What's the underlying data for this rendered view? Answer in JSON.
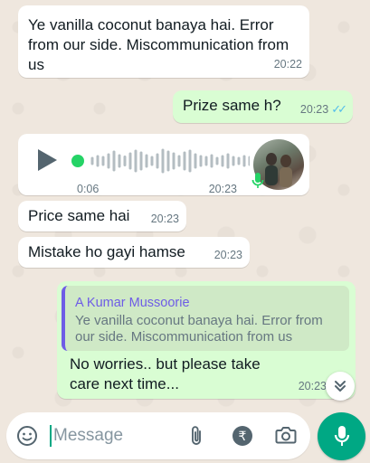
{
  "messages": [
    {
      "id": "m1",
      "direction": "incoming",
      "text": "Ye vanilla coconut banaya hai. Error from our side. Miscommunication from us",
      "time": "20:22"
    },
    {
      "id": "m2",
      "direction": "outgoing",
      "text": "Prize same h?",
      "time": "20:23",
      "status": "read"
    },
    {
      "id": "voice",
      "direction": "incoming",
      "type": "voice",
      "duration": "0:06",
      "time": "20:23"
    },
    {
      "id": "m3",
      "direction": "incoming",
      "text": "Price same hai",
      "time": "20:23"
    },
    {
      "id": "m4",
      "direction": "incoming",
      "text": "Mistake ho gayi hamse",
      "time": "20:23"
    },
    {
      "id": "m5",
      "direction": "outgoing",
      "text": "No worries.. but please take care next time...",
      "time": "20:23",
      "reply_to": {
        "author": "A Kumar Mussoorie",
        "text": "Ye vanilla coconut banaya hai. Error from our side. Miscommunication from us"
      }
    }
  ],
  "input": {
    "placeholder": "Message"
  },
  "colors": {
    "accent": "#00a884",
    "outgoing_bubble": "#d9fdd3",
    "incoming_bubble": "#ffffff",
    "read_tick": "#53bdeb",
    "quote_author": "#6e5ce6"
  },
  "icons": [
    "play-icon",
    "mic-icon",
    "emoji-icon",
    "attach-icon",
    "rupee-icon",
    "camera-icon",
    "chevron-double-down-icon",
    "double-tick-icon"
  ]
}
